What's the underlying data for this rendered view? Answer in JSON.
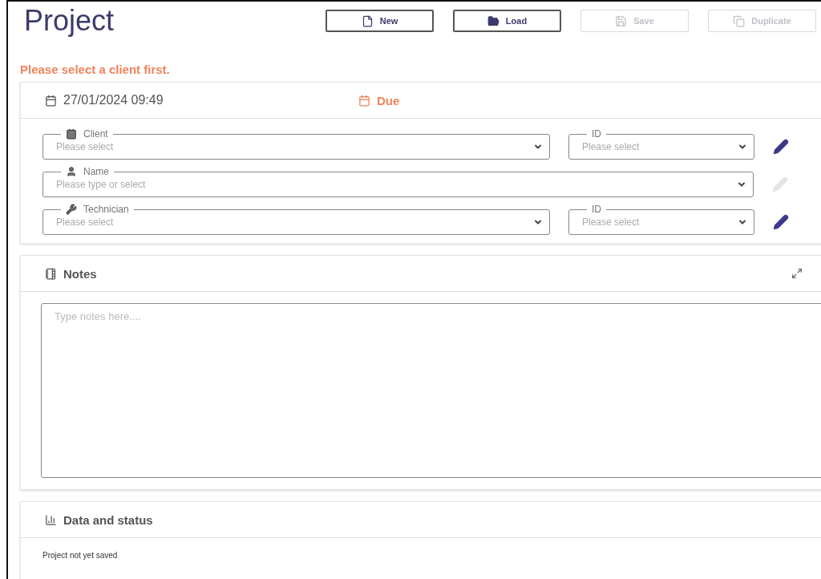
{
  "title": "Project",
  "buttons": [
    {
      "label": "New",
      "disabled": false
    },
    {
      "label": "Load",
      "disabled": false
    },
    {
      "label": "Save",
      "disabled": true
    },
    {
      "label": "Duplicate",
      "disabled": true
    }
  ],
  "warning": "Please select a client first.",
  "details": {
    "date": "27/01/2024 09:49",
    "due": "Due",
    "rows": [
      {
        "edit_disabled": false,
        "fields": [
          {
            "label": "Client",
            "placeholder": "Please select"
          },
          {
            "label": "ID",
            "placeholder": "Please select"
          }
        ]
      },
      {
        "edit_disabled": true,
        "fields": [
          {
            "label": "Name",
            "placeholder": "Please type or select"
          }
        ]
      },
      {
        "edit_disabled": false,
        "fields": [
          {
            "label": "Technician",
            "placeholder": "Please select"
          },
          {
            "label": "ID",
            "placeholder": "Please select"
          }
        ]
      }
    ]
  },
  "notes": {
    "title": "Notes",
    "placeholder": "Type notes here...."
  },
  "status": {
    "title": "Data and status",
    "text": "Project not yet saved"
  }
}
